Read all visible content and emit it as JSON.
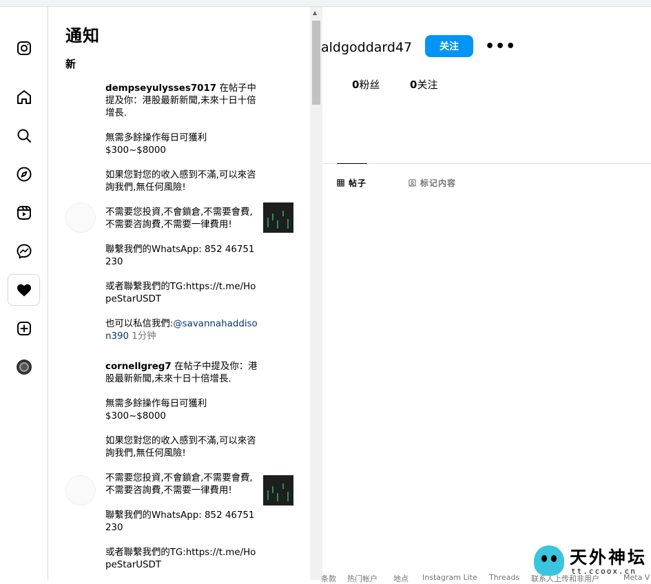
{
  "sidebar": {
    "items": [
      {
        "name": "instagram-icon",
        "label": "Instagram"
      },
      {
        "name": "home-icon",
        "label": "首页"
      },
      {
        "name": "search-icon",
        "label": "搜索"
      },
      {
        "name": "explore-icon",
        "label": "发现"
      },
      {
        "name": "reels-icon",
        "label": "Reels"
      },
      {
        "name": "messenger-icon",
        "label": "消息"
      },
      {
        "name": "heart-icon",
        "label": "通知",
        "active": true
      },
      {
        "name": "create-icon",
        "label": "创建"
      },
      {
        "name": "profile-avatar",
        "label": "主页"
      }
    ]
  },
  "notifications": {
    "title": "通知",
    "section_new": "新",
    "items": [
      {
        "user": "dempseyulysses7017",
        "action": " 在帖子中提及你：港股最新新聞,未來十日十倍增長.",
        "body": "\n\n無需多餘操作每日可獲利\n$300~$8000\n\n如果您對您的收入感到不滿,可以來咨詢我們,無任何風險!\n\n不需要您投資,不會鎖倉,不需要會費,不需要咨詢費,不需要一律費用!\n\n聯繫我們的WhatsApp: 852 46751230\n\n或者聯繫我們的TG:https://t.me/HopeStarUSDT\n\n也可以私信我們:",
        "mention": "@savannahaddison390",
        "time": " 1分钟"
      },
      {
        "user": "cornellgreg7",
        "action": " 在帖子中提及你：港股最新新聞,未來十日十倍增長.",
        "body": "\n\n無需多餘操作每日可獲利\n$300~$8000\n\n如果您對您的收入感到不滿,可以來咨詢我們,無任何風險!\n\n不需要您投資,不會鎖倉,不需要會費,不需要咨詢費,不需要一律費用!\n\n聯繫我們的WhatsApp: 852 46751230\n\n或者聯繫我們的TG:https://t.me/HopeStarUSDT",
        "mention": "",
        "time": ""
      }
    ]
  },
  "profile": {
    "username": "aldgoddard47",
    "follow_label": "关注",
    "more_label": "•••",
    "followers_count": "0",
    "followers_label": "粉丝",
    "following_count": "0",
    "following_label": "关注",
    "tabs": [
      {
        "label": "帖子",
        "icon": "grid-icon",
        "active": true
      },
      {
        "label": "标记内容",
        "icon": "tagged-icon",
        "active": false
      }
    ]
  },
  "footer": {
    "links": [
      "条款",
      "热门帐户",
      "地点",
      "Instagram Lite",
      "Threads",
      "联系人上传和非用户",
      "Meta V"
    ]
  },
  "watermark": {
    "title": "天外神坛",
    "url": "tt.ccoox.cn"
  },
  "colors": {
    "accent": "#0095f6",
    "mention": "#00376b",
    "secondary_text": "#737373",
    "border": "#dbdbdb"
  }
}
